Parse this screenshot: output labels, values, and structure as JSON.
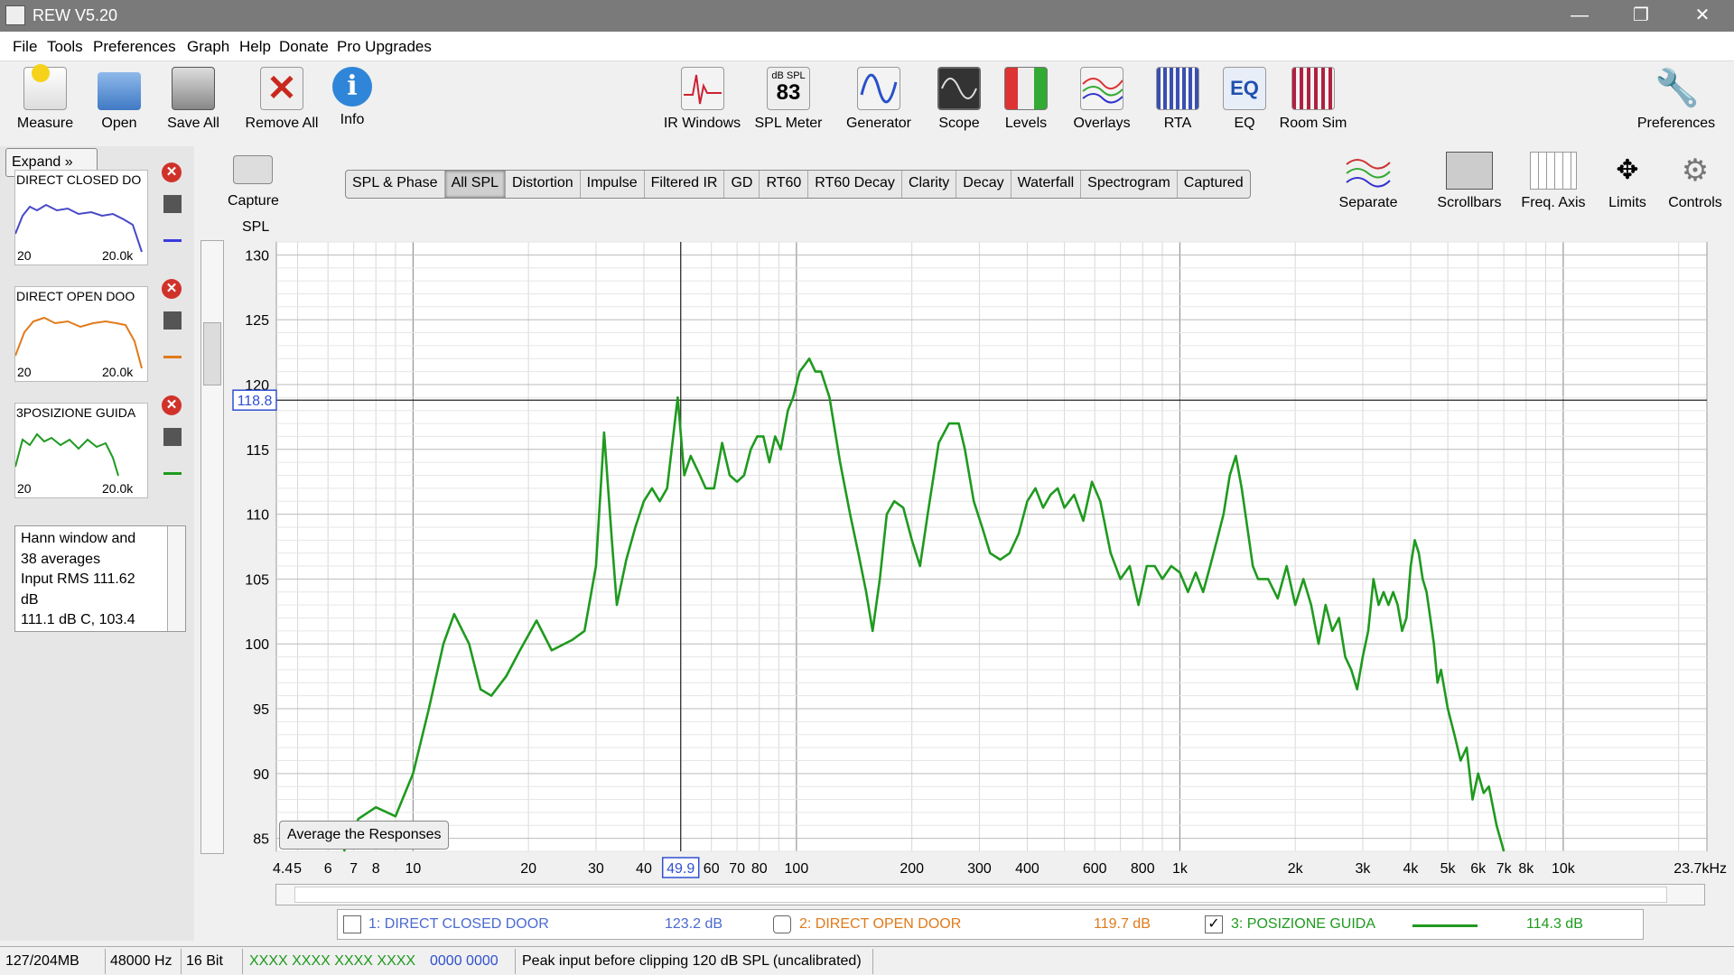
{
  "window": {
    "title": "REW V5.20",
    "minimize": "—",
    "restore": "❐",
    "close": "✕"
  },
  "menu": [
    "File",
    "Tools",
    "Preferences",
    "Graph",
    "Help",
    "Donate",
    "Pro Upgrades"
  ],
  "toolbar": {
    "left": [
      {
        "label": "Measure",
        "icon": "measure-icon"
      },
      {
        "label": "Open",
        "icon": "folder-icon"
      },
      {
        "label": "Save All",
        "icon": "save-all-icon"
      },
      {
        "label": "Remove All",
        "icon": "remove-all-icon"
      },
      {
        "label": "Info",
        "icon": "info-icon"
      }
    ],
    "center": [
      {
        "label": "IR Windows",
        "icon": "ir-windows-icon"
      },
      {
        "label": "SPL Meter",
        "icon": "spl-meter-icon",
        "badge_top": "dB SPL",
        "badge_value": "83"
      },
      {
        "label": "Generator",
        "icon": "generator-icon"
      },
      {
        "label": "Scope",
        "icon": "scope-icon"
      },
      {
        "label": "Levels",
        "icon": "levels-icon"
      },
      {
        "label": "Overlays",
        "icon": "overlays-icon"
      },
      {
        "label": "RTA",
        "icon": "rta-icon"
      },
      {
        "label": "EQ",
        "icon": "eq-icon"
      },
      {
        "label": "Room Sim",
        "icon": "room-sim-icon"
      }
    ],
    "right": [
      {
        "label": "Preferences",
        "icon": "wrench-icon"
      }
    ]
  },
  "left_panel": {
    "expand_label": "Expand",
    "measurements": [
      {
        "name": "DIRECT CLOSED DOOR",
        "thumb_label": "DIRECT CLOSED DO",
        "x_start": "20",
        "x_end": "20.0k",
        "color": "#4848c8"
      },
      {
        "name": "DIRECT OPEN DOOR",
        "thumb_label": "DIRECT OPEN DOO",
        "x_start": "20",
        "x_end": "20.0k",
        "color": "#e07a1a"
      },
      {
        "name": "POSIZIONE GUIDA",
        "thumb_label": "3POSIZIONE GUIDA",
        "x_start": "20",
        "x_end": "20.0k",
        "color": "#1f9a1f"
      }
    ],
    "notes": [
      "Hann window and",
      "38 averages",
      "Input RMS 111.62",
      "dB",
      "111.1 dB C, 103.4"
    ]
  },
  "capture_label": "Capture",
  "graph_tabs": [
    "SPL & Phase",
    "All SPL",
    "Distortion",
    "Impulse",
    "Filtered IR",
    "GD",
    "RT60",
    "RT60 Decay",
    "Clarity",
    "Decay",
    "Waterfall",
    "Spectrogram",
    "Captured"
  ],
  "active_tab": "All SPL",
  "right_tools": [
    {
      "label": "Separate",
      "icon": "separate-icon"
    },
    {
      "label": "Scrollbars",
      "icon": "scrollbars-icon"
    },
    {
      "label": "Freq. Axis",
      "icon": "freq-axis-icon"
    },
    {
      "label": "Limits",
      "icon": "limits-icon"
    },
    {
      "label": "Controls",
      "icon": "controls-icon"
    }
  ],
  "avg_button": "Average the Responses",
  "legend": [
    {
      "index": "1: DIRECT CLOSED DOOR",
      "value": "123.2 dB",
      "checked": false,
      "color": "#4a6ad0"
    },
    {
      "index": "2: DIRECT OPEN DOOR",
      "value": "119.7 dB",
      "checked": false,
      "color": "#e07a1a"
    },
    {
      "index": "3: POSIZIONE GUIDA",
      "value": "114.3 dB",
      "checked": true,
      "color": "#1f9a1f"
    }
  ],
  "status": {
    "memory": "127/204MB",
    "sample_rate": "48000 Hz",
    "bits": "16 Bit",
    "meter_green": "XXXX XXXX  XXXX XXXX",
    "meter_blue": "0000 0000",
    "message": "Peak input before clipping 120 dB SPL (uncalibrated)"
  },
  "chart_data": {
    "type": "line",
    "ylabel": "SPL",
    "xlim_hz": [
      4.4,
      23700
    ],
    "ylim": [
      84,
      131
    ],
    "x_scale": "log",
    "y_ticks": [
      "85",
      "90",
      "95",
      "100",
      "105",
      "110",
      "115",
      "120",
      "125",
      "130"
    ],
    "y_tick_values": [
      85,
      90,
      95,
      100,
      105,
      110,
      115,
      120,
      125,
      130
    ],
    "x_ticks": [
      "4.4",
      "5",
      "6",
      "7",
      "8",
      "10",
      "20",
      "30",
      "40",
      "60",
      "70",
      "80",
      "100",
      "200",
      "300",
      "400",
      "600",
      "800",
      "1k",
      "2k",
      "3k",
      "4k",
      "5k",
      "6k",
      "7k",
      "8k",
      "10k",
      "23.7kHz"
    ],
    "x_tick_values": [
      4.4,
      5,
      6,
      7,
      8,
      10,
      20,
      30,
      40,
      60,
      70,
      80,
      100,
      200,
      300,
      400,
      600,
      800,
      1000,
      2000,
      3000,
      4000,
      5000,
      6000,
      7000,
      8000,
      10000,
      23700
    ],
    "cursor": {
      "x": 49.9,
      "y": 118.8,
      "x_label": "49.9",
      "y_label": "118.8"
    },
    "grid": true,
    "series": [
      {
        "name": "3: POSIZIONE GUIDA",
        "color": "#1f9a1f",
        "points": [
          [
            6.6,
            84
          ],
          [
            7.2,
            86.5
          ],
          [
            8,
            87.4
          ],
          [
            9,
            86.7
          ],
          [
            10,
            90
          ],
          [
            11,
            95
          ],
          [
            12,
            100
          ],
          [
            12.8,
            102.3
          ],
          [
            14,
            100
          ],
          [
            15,
            96.5
          ],
          [
            16,
            96
          ],
          [
            17.5,
            97.5
          ],
          [
            19,
            99.5
          ],
          [
            21,
            101.8
          ],
          [
            23,
            99.5
          ],
          [
            26,
            100.3
          ],
          [
            28,
            101
          ],
          [
            30,
            106
          ],
          [
            31.5,
            116.3
          ],
          [
            33,
            108
          ],
          [
            34,
            103
          ],
          [
            36,
            106.5
          ],
          [
            38,
            109
          ],
          [
            40,
            111
          ],
          [
            42,
            112
          ],
          [
            44,
            111
          ],
          [
            46,
            112
          ],
          [
            49,
            119
          ],
          [
            51,
            113
          ],
          [
            53,
            114.5
          ],
          [
            56,
            113
          ],
          [
            58,
            112
          ],
          [
            61,
            112
          ],
          [
            64,
            115.5
          ],
          [
            67,
            113
          ],
          [
            70,
            112.5
          ],
          [
            73,
            113
          ],
          [
            76,
            115
          ],
          [
            79,
            116
          ],
          [
            82,
            116
          ],
          [
            85,
            114
          ],
          [
            88,
            116
          ],
          [
            91,
            115
          ],
          [
            95,
            118
          ],
          [
            98,
            119
          ],
          [
            102,
            121
          ],
          [
            105,
            121.5
          ],
          [
            108,
            122
          ],
          [
            112,
            121
          ],
          [
            116,
            121
          ],
          [
            122,
            119
          ],
          [
            130,
            114
          ],
          [
            138,
            110
          ],
          [
            145,
            107
          ],
          [
            152,
            104
          ],
          [
            158,
            101
          ],
          [
            165,
            105
          ],
          [
            172,
            110
          ],
          [
            180,
            111
          ],
          [
            190,
            110.5
          ],
          [
            200,
            108
          ],
          [
            210,
            106
          ],
          [
            220,
            110
          ],
          [
            235,
            115.5
          ],
          [
            250,
            117
          ],
          [
            265,
            117
          ],
          [
            275,
            115
          ],
          [
            290,
            111
          ],
          [
            305,
            109
          ],
          [
            320,
            107
          ],
          [
            340,
            106.5
          ],
          [
            360,
            107
          ],
          [
            380,
            108.5
          ],
          [
            400,
            111
          ],
          [
            420,
            112
          ],
          [
            440,
            110.5
          ],
          [
            460,
            111.5
          ],
          [
            480,
            112
          ],
          [
            500,
            110.5
          ],
          [
            530,
            111.5
          ],
          [
            560,
            109.5
          ],
          [
            590,
            112.5
          ],
          [
            620,
            111
          ],
          [
            660,
            107
          ],
          [
            700,
            105
          ],
          [
            740,
            106
          ],
          [
            780,
            103
          ],
          [
            820,
            106
          ],
          [
            860,
            106
          ],
          [
            900,
            105
          ],
          [
            950,
            106
          ],
          [
            1000,
            105.5
          ],
          [
            1050,
            104
          ],
          [
            1100,
            105.5
          ],
          [
            1150,
            104
          ],
          [
            1200,
            106
          ],
          [
            1250,
            108
          ],
          [
            1300,
            110
          ],
          [
            1350,
            113
          ],
          [
            1400,
            114.5
          ],
          [
            1450,
            112
          ],
          [
            1500,
            109
          ],
          [
            1550,
            106
          ],
          [
            1600,
            105
          ],
          [
            1700,
            105
          ],
          [
            1800,
            103.5
          ],
          [
            1900,
            106
          ],
          [
            2000,
            103
          ],
          [
            2100,
            105
          ],
          [
            2200,
            103
          ],
          [
            2300,
            100
          ],
          [
            2400,
            103
          ],
          [
            2500,
            101
          ],
          [
            2600,
            102
          ],
          [
            2700,
            99
          ],
          [
            2800,
            98
          ],
          [
            2900,
            96.5
          ],
          [
            3000,
            99
          ],
          [
            3100,
            101
          ],
          [
            3200,
            105
          ],
          [
            3300,
            103
          ],
          [
            3400,
            104
          ],
          [
            3500,
            103
          ],
          [
            3600,
            104
          ],
          [
            3700,
            103
          ],
          [
            3800,
            101
          ],
          [
            3900,
            102
          ],
          [
            4000,
            106
          ],
          [
            4100,
            108
          ],
          [
            4200,
            107
          ],
          [
            4300,
            105
          ],
          [
            4400,
            104
          ],
          [
            4500,
            102
          ],
          [
            4600,
            100
          ],
          [
            4700,
            97
          ],
          [
            4800,
            98
          ],
          [
            5000,
            95
          ],
          [
            5200,
            93
          ],
          [
            5400,
            91
          ],
          [
            5600,
            92
          ],
          [
            5800,
            88
          ],
          [
            6000,
            90
          ],
          [
            6200,
            88.5
          ],
          [
            6400,
            89
          ],
          [
            6700,
            86
          ],
          [
            7000,
            84
          ]
        ]
      }
    ]
  }
}
